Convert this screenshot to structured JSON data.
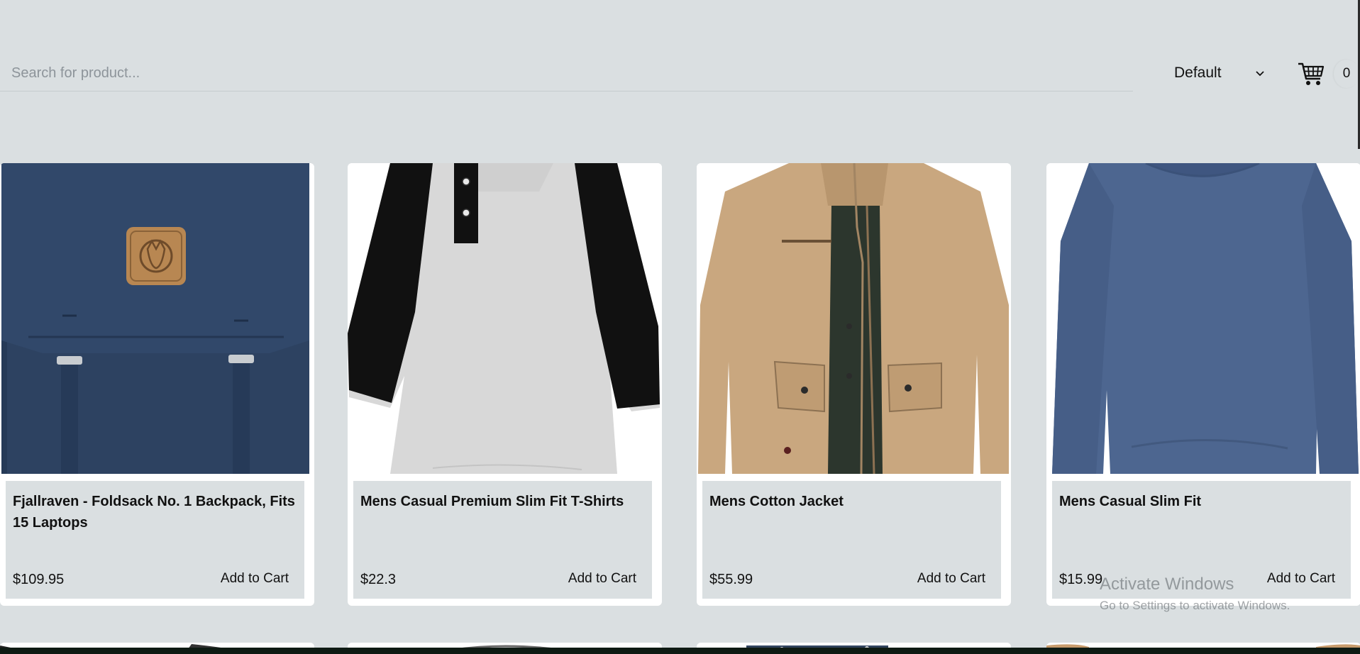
{
  "search": {
    "placeholder": "Search for product..."
  },
  "sort": {
    "selected": "Default"
  },
  "cart": {
    "icon": "shopping-cart-icon",
    "count": "0"
  },
  "products": [
    {
      "title": "Fjallraven - Foldsack No. 1 Backpack, Fits 15 Laptops",
      "price": "$109.95",
      "button": "Add to Cart",
      "image": "navy backpack"
    },
    {
      "title": "Mens Casual Premium Slim Fit T-Shirts",
      "price": "$22.3",
      "button": "Add to Cart",
      "image": "raglan t-shirt"
    },
    {
      "title": "Mens Cotton Jacket",
      "price": "$55.99",
      "button": "Add to Cart",
      "image": "khaki jacket"
    },
    {
      "title": "Mens Casual Slim Fit",
      "price": "$15.99",
      "button": "Add to Cart",
      "image": "blue long-sleeve shirt"
    }
  ],
  "watermark": {
    "title": "Activate Windows",
    "subtitle": "Go to Settings to activate Windows."
  },
  "colors": {
    "background": "#dadfe1",
    "card": "#ffffff",
    "info_panel": "#dadfe1",
    "backpack": "#2d4261",
    "shirt_grey": "#d6d6d6",
    "jacket": "#c9a77f",
    "blue_shirt": "#4d6690"
  }
}
